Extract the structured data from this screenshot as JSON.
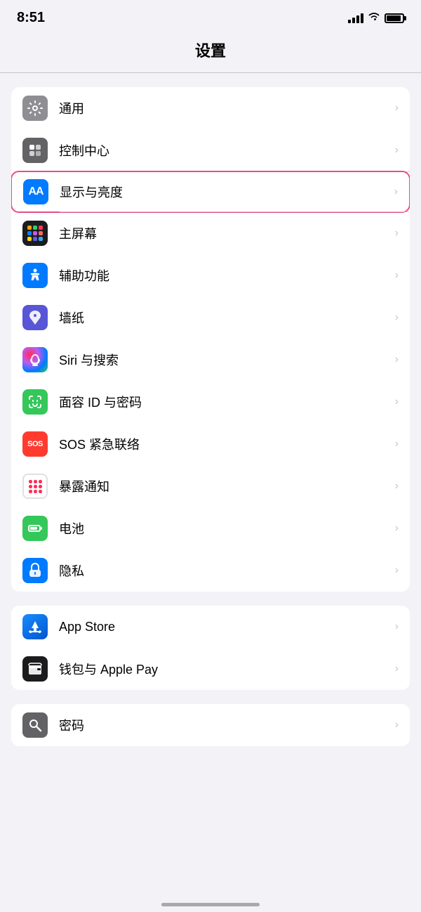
{
  "statusBar": {
    "time": "8:51",
    "signalLabel": "signal",
    "wifiLabel": "wifi",
    "batteryLabel": "battery"
  },
  "pageTitle": "设置",
  "groups": [
    {
      "id": "group1",
      "items": [
        {
          "id": "general",
          "label": "通用",
          "iconBg": "gray",
          "iconType": "gear",
          "highlighted": false
        },
        {
          "id": "control-center",
          "label": "控制中心",
          "iconBg": "gray2",
          "iconType": "toggle",
          "highlighted": false
        },
        {
          "id": "display",
          "label": "显示与亮度",
          "iconBg": "blue",
          "iconType": "aa",
          "highlighted": true
        },
        {
          "id": "home-screen",
          "label": "主屏幕",
          "iconBg": "multicolor",
          "iconType": "dots",
          "highlighted": false
        },
        {
          "id": "accessibility",
          "label": "辅助功能",
          "iconBg": "blue2",
          "iconType": "person",
          "highlighted": false
        },
        {
          "id": "wallpaper",
          "label": "墙纸",
          "iconBg": "purple",
          "iconType": "flower",
          "highlighted": false
        },
        {
          "id": "siri",
          "label": "Siri 与搜索",
          "iconBg": "siri",
          "iconType": "siri",
          "highlighted": false
        },
        {
          "id": "faceid",
          "label": "面容 ID 与密码",
          "iconBg": "green",
          "iconType": "face",
          "highlighted": false
        },
        {
          "id": "sos",
          "label": "SOS 紧急联络",
          "iconBg": "red",
          "iconType": "sos",
          "highlighted": false
        },
        {
          "id": "exposure",
          "label": "暴露通知",
          "iconBg": "white",
          "iconType": "exposure",
          "highlighted": false
        },
        {
          "id": "battery",
          "label": "电池",
          "iconBg": "green",
          "iconType": "battery",
          "highlighted": false
        },
        {
          "id": "privacy",
          "label": "隐私",
          "iconBg": "blue3",
          "iconType": "hand",
          "highlighted": false
        }
      ]
    },
    {
      "id": "group2",
      "items": [
        {
          "id": "appstore",
          "label": "App Store",
          "iconBg": "appstore",
          "iconType": "appstore",
          "highlighted": false
        },
        {
          "id": "wallet",
          "label": "钱包与 Apple Pay",
          "iconBg": "wallet",
          "iconType": "wallet",
          "highlighted": false
        }
      ]
    },
    {
      "id": "group3",
      "items": [
        {
          "id": "passwords",
          "label": "密码",
          "iconBg": "keychain",
          "iconType": "key",
          "highlighted": false
        }
      ]
    }
  ],
  "chevron": "›"
}
